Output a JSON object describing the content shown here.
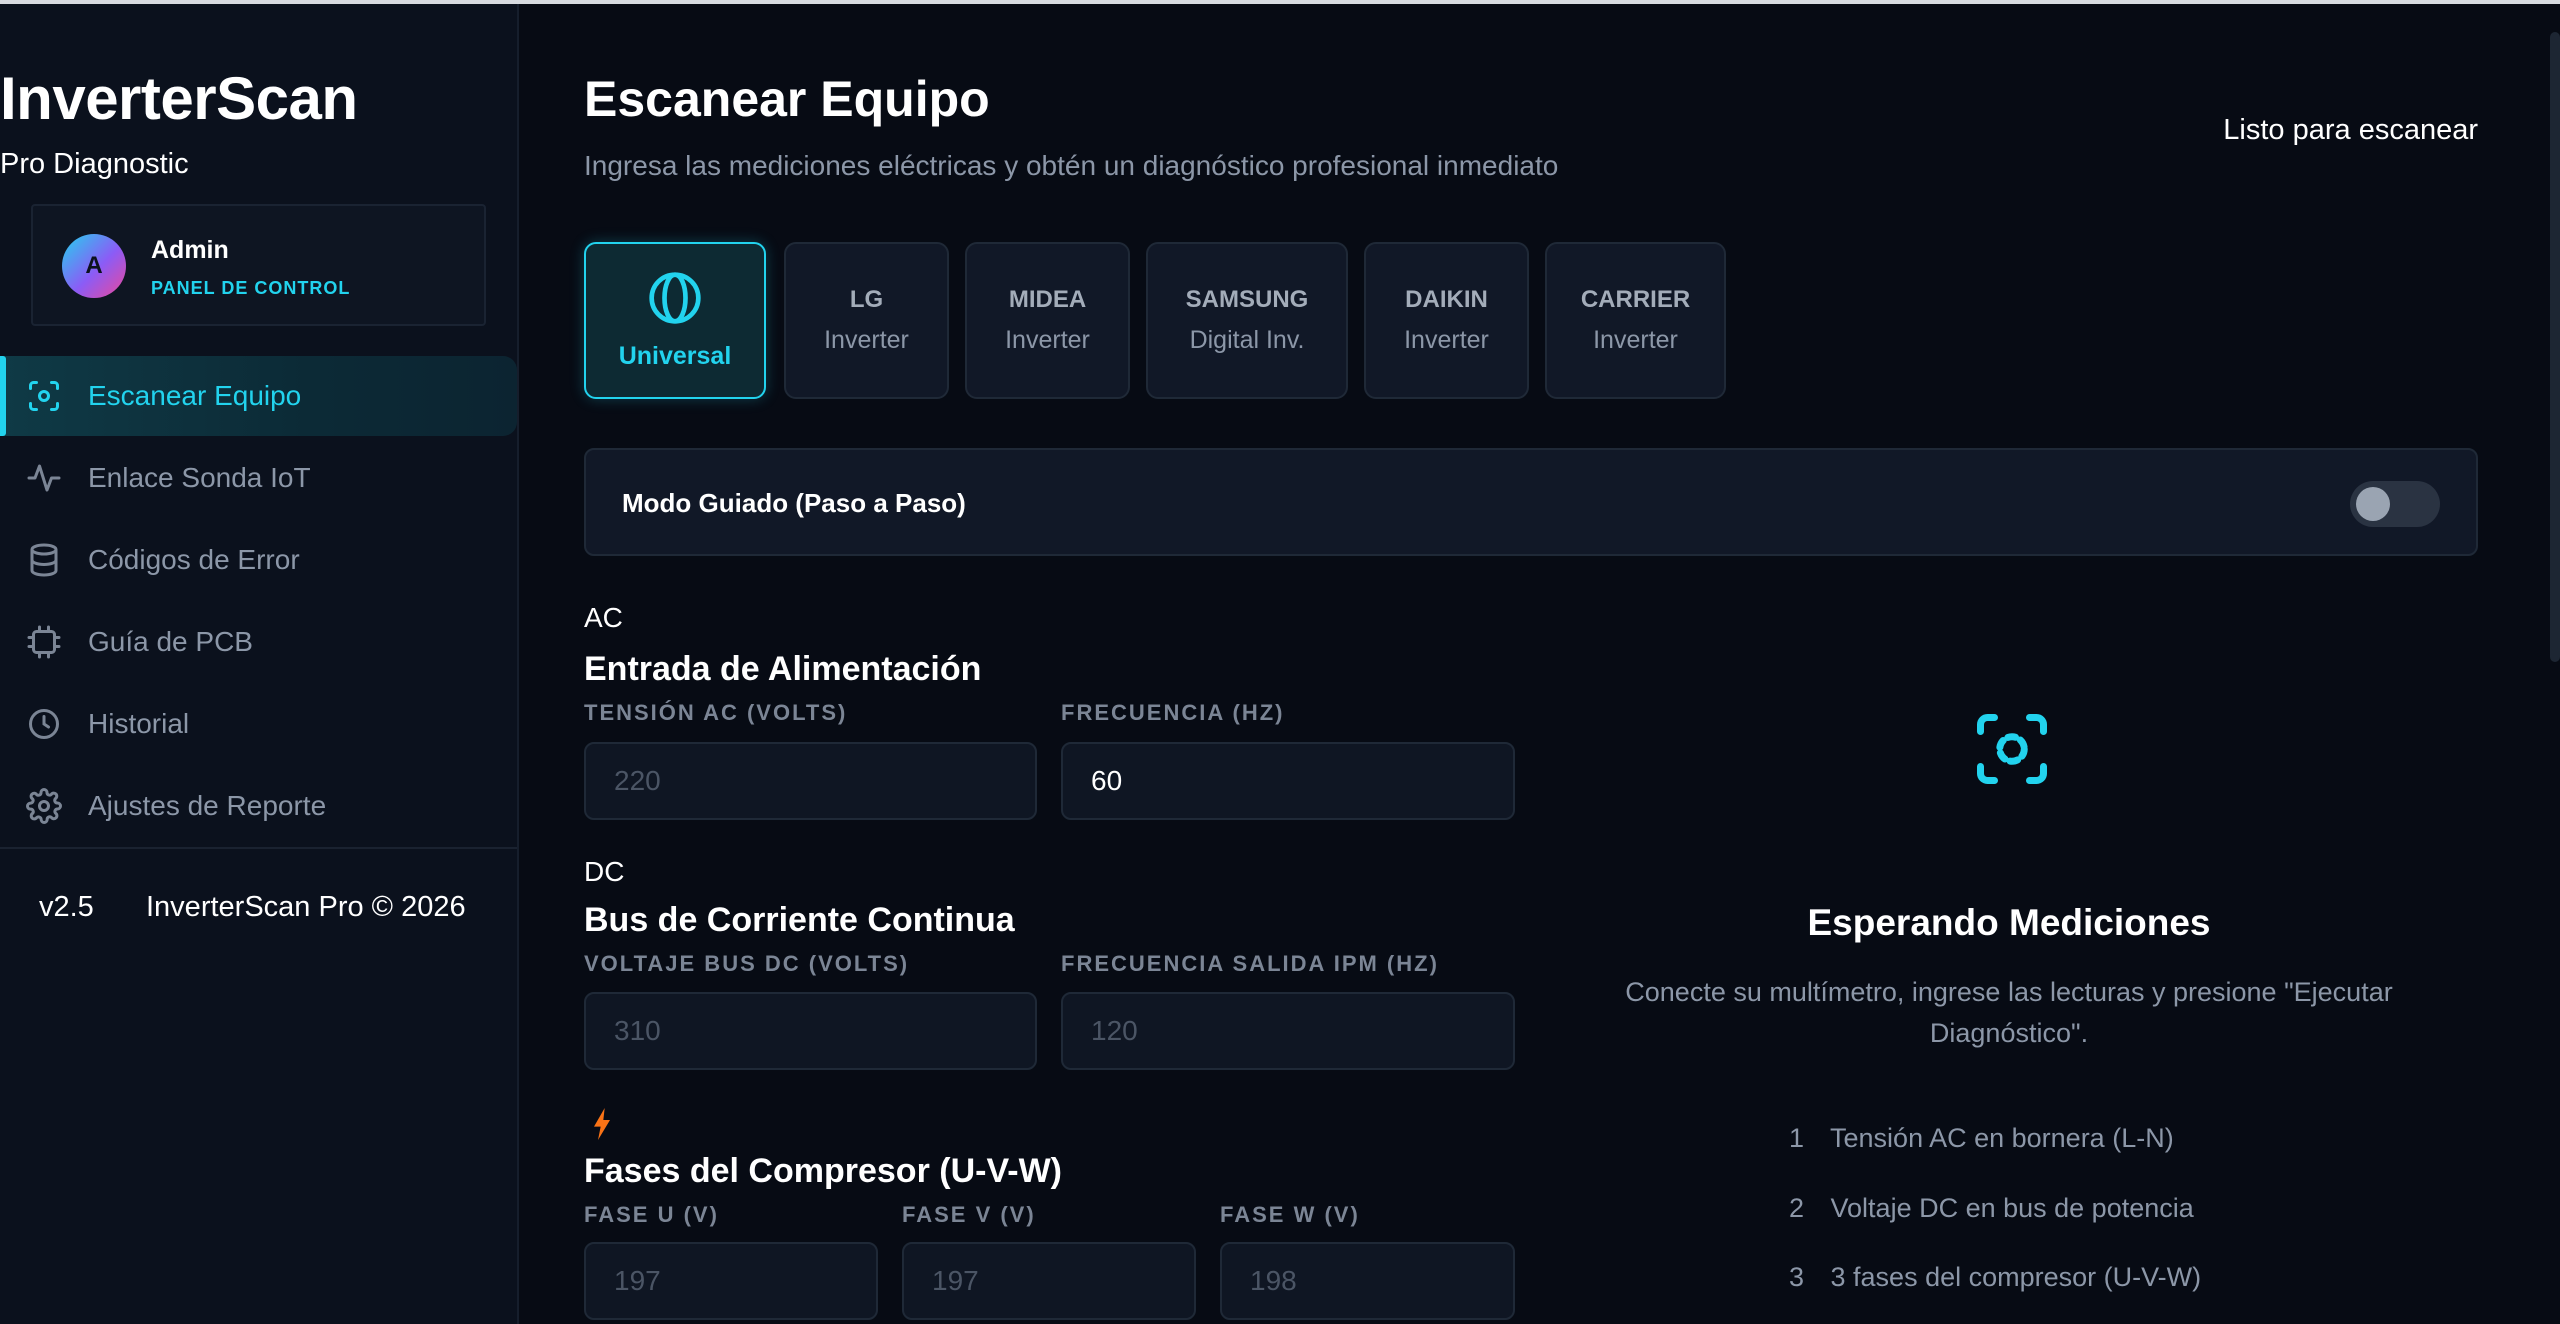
{
  "app": {
    "name": "InverterScan",
    "subtitle": "Pro Diagnostic",
    "version": "v2.5",
    "copyright": "InverterScan Pro © 2026",
    "accent": "#22d3ee"
  },
  "user": {
    "initial": "A",
    "name": "Admin",
    "role": "PANEL DE CONTROL"
  },
  "nav": [
    {
      "label": "Escanear Equipo",
      "icon": "scan-icon",
      "active": true
    },
    {
      "label": "Enlace Sonda IoT",
      "icon": "activity-icon",
      "active": false
    },
    {
      "label": "Códigos de Error",
      "icon": "database-icon",
      "active": false
    },
    {
      "label": "Guía de PCB",
      "icon": "chip-icon",
      "active": false
    },
    {
      "label": "Historial",
      "icon": "clock-icon",
      "active": false
    },
    {
      "label": "Ajustes de Reporte",
      "icon": "gear-icon",
      "active": false
    }
  ],
  "header": {
    "title": "Escanear Equipo",
    "subtitle": "Ingresa las mediciones eléctricas y obtén un diagnóstico profesional inmediato",
    "status": "Listo para escanear"
  },
  "brands": [
    {
      "name": "Universal",
      "type": "",
      "icon": "globe-icon",
      "selected": true
    },
    {
      "name": "LG",
      "type": "Inverter",
      "selected": false
    },
    {
      "name": "MIDEA",
      "type": "Inverter",
      "selected": false
    },
    {
      "name": "SAMSUNG",
      "type": "Digital Inv.",
      "selected": false
    },
    {
      "name": "DAIKIN",
      "type": "Inverter",
      "selected": false
    },
    {
      "name": "CARRIER",
      "type": "Inverter",
      "selected": false
    }
  ],
  "guided_mode": {
    "label": "Modo Guiado (Paso a Paso)",
    "enabled": false
  },
  "sections": {
    "ac": {
      "tag": "AC",
      "title": "Entrada de Alimentación",
      "fields": [
        {
          "label": "TENSIÓN AC (VOLTS)",
          "value": "",
          "placeholder": "220"
        },
        {
          "label": "FRECUENCIA (HZ)",
          "value": "60",
          "placeholder": ""
        }
      ]
    },
    "dc": {
      "tag": "DC",
      "title": "Bus de Corriente Continua",
      "fields": [
        {
          "label": "VOLTAJE BUS DC (VOLTS)",
          "value": "",
          "placeholder": "310"
        },
        {
          "label": "FRECUENCIA SALIDA IPM (HZ)",
          "value": "",
          "placeholder": "120"
        }
      ]
    },
    "phases": {
      "icon": "bolt-icon",
      "title": "Fases del Compresor (U-V-W)",
      "fields": [
        {
          "label": "FASE U (V)",
          "value": "",
          "placeholder": "197"
        },
        {
          "label": "FASE V (V)",
          "value": "",
          "placeholder": "197"
        },
        {
          "label": "FASE W (V)",
          "value": "",
          "placeholder": "198"
        }
      ]
    }
  },
  "waiting": {
    "title": "Esperando Mediciones",
    "description": "Conecte su multímetro, ingrese las lecturas y presione \"Ejecutar Diagnóstico\".",
    "steps": [
      {
        "num": "1",
        "text": "Tensión AC en bornera (L-N)"
      },
      {
        "num": "2",
        "text": "Voltaje DC en bus de potencia"
      },
      {
        "num": "3",
        "text": "3 fases del compresor (U-V-W)"
      }
    ]
  }
}
